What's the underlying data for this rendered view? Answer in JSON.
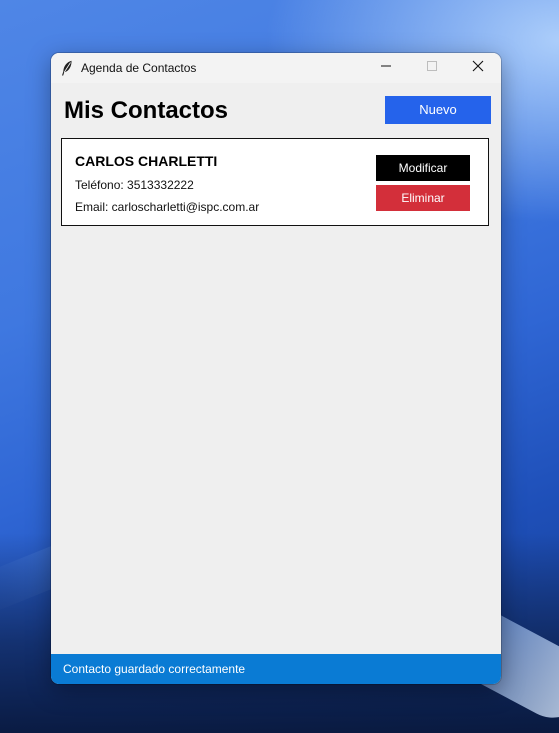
{
  "window": {
    "title": "Agenda de Contactos",
    "icon": "feather-icon",
    "controls": [
      "minimize-icon",
      "maximize-icon",
      "close-icon"
    ]
  },
  "header": {
    "title": "Mis Contactos",
    "new_label": "Nuevo"
  },
  "contacts": [
    {
      "name": "CARLOS CHARLETTI",
      "phone": "Teléfono: 3513332222",
      "email": "Email: carloscharletti@ispc.com.ar",
      "modify_label": "Modificar",
      "delete_label": "Eliminar"
    }
  ],
  "status": {
    "message": "Contacto guardado correctamente"
  },
  "colors": {
    "accent": "#2563eb",
    "danger": "#d32f3a",
    "statusbar": "#0a7bd4"
  }
}
